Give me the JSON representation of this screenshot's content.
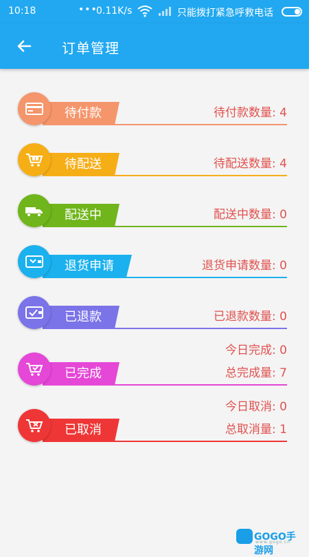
{
  "status_bar": {
    "time": "10:18",
    "dots": "•••",
    "speed": "0.11K/s",
    "emergency": "只能拨打紧急呼救电话",
    "wifi_icon": "wifi-icon",
    "battery_icon": "battery-icon"
  },
  "app_bar": {
    "title": "订单管理",
    "back_icon": "arrow-left-icon"
  },
  "orders": [
    {
      "label": "待付款",
      "count_text": "待付款数量: 4",
      "color": "#f5956b",
      "icon": "card-icon"
    },
    {
      "label": "待配送",
      "count_text": "待配送数量: 4",
      "color": "#f6ae17",
      "icon": "cart-icon"
    },
    {
      "label": "配送中",
      "count_text": "配送中数量: 0",
      "color": "#6fb51b",
      "icon": "truck-icon"
    },
    {
      "label": "退货申请",
      "count_text": "退货申请数量: 0",
      "color": "#1ab1ee",
      "icon": "return-card-icon"
    },
    {
      "label": "已退款",
      "count_text": "已退款数量: 0",
      "color": "#7b73e8",
      "icon": "wallet-check-icon"
    },
    {
      "label": "已完成",
      "count_today": "今日完成: 0",
      "count_text": "总完成量: 7",
      "color": "#e547d7",
      "icon": "cart-check-icon"
    },
    {
      "label": "已取消",
      "count_today": "今日取消: 0",
      "count_text": "总取消量: 1",
      "color": "#ef3636",
      "icon": "cart-x-icon"
    }
  ],
  "watermark": {
    "text": "GOGO手游网",
    "sub": "www.gogo.cn"
  }
}
